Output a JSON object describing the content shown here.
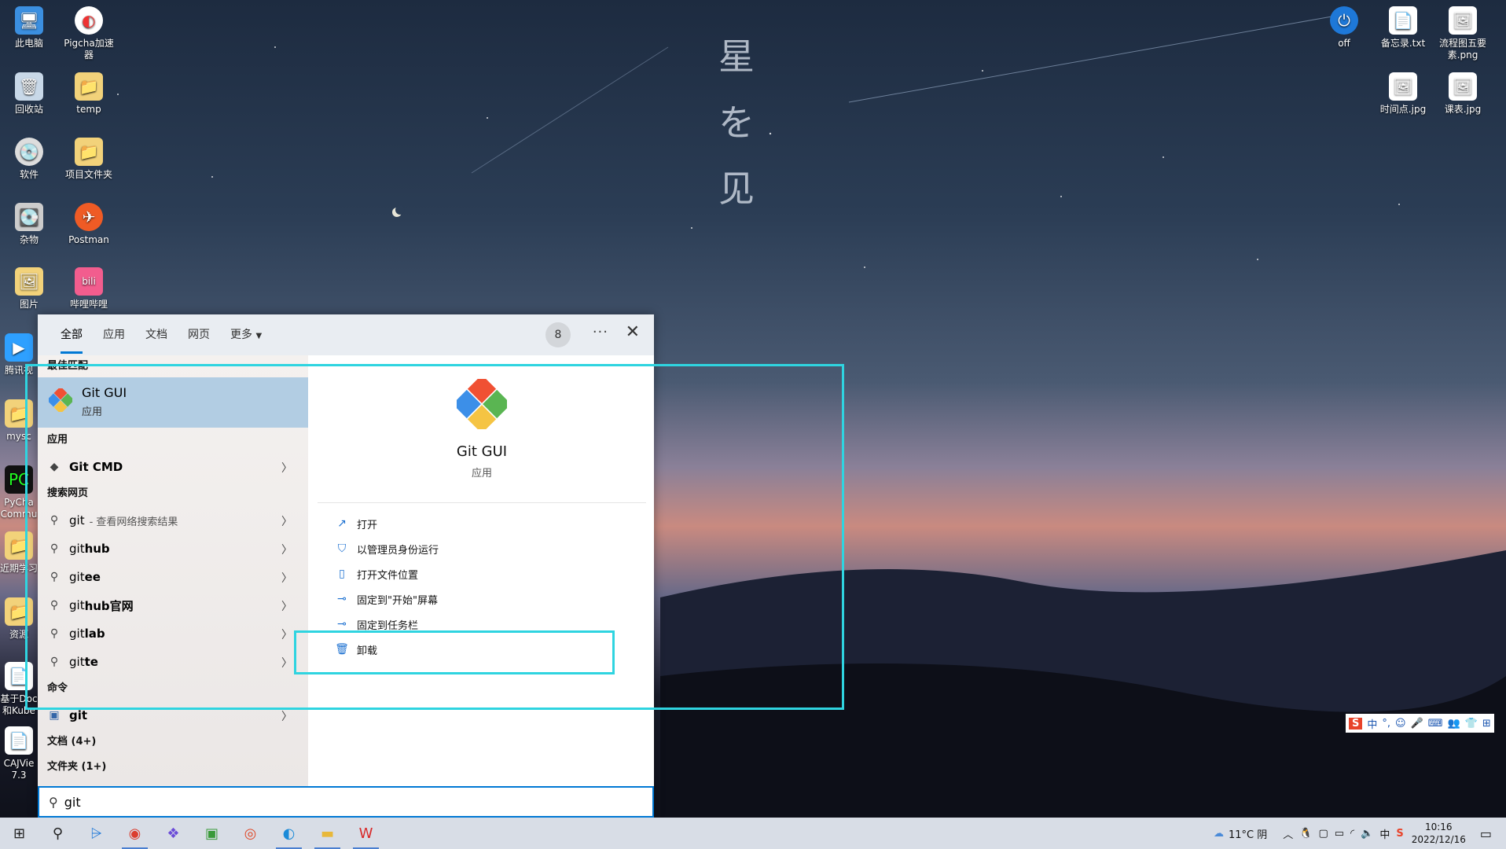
{
  "desktop": {
    "icons_left": [
      {
        "label": "此电脑",
        "icon": "computer-icon"
      },
      {
        "label": "Pigcha加速器",
        "icon": "pigcha-icon"
      },
      {
        "label": "回收站",
        "icon": "recycle-bin-icon"
      },
      {
        "label": "temp",
        "icon": "folder-icon"
      },
      {
        "label": "软件",
        "icon": "dvd-drive-icon"
      },
      {
        "label": "项目文件夹",
        "icon": "folder-icon"
      },
      {
        "label": "杂物",
        "icon": "drive-icon"
      },
      {
        "label": "Postman",
        "icon": "postman-icon"
      },
      {
        "label": "图片",
        "icon": "pictures-icon"
      },
      {
        "label": "哔哩哔哩",
        "icon": "bilibili-icon"
      }
    ],
    "icons_partial": [
      "腾讯视",
      "mysc",
      "PyCha Commu",
      "近期学习",
      "资源",
      "基于Doc和Kube",
      "CAJVie 7.3"
    ],
    "icons_right": [
      {
        "label": "off",
        "icon": "power-icon"
      },
      {
        "label": "备忘录.txt",
        "icon": "text-file-icon"
      },
      {
        "label": "流程图五要素.png",
        "icon": "image-file-icon"
      },
      {
        "label": "时间点.jpg",
        "icon": "image-file-icon"
      },
      {
        "label": "课表.jpg",
        "icon": "image-file-icon"
      }
    ],
    "poem": [
      "星",
      "を",
      "见"
    ]
  },
  "search": {
    "tabs": [
      "全部",
      "应用",
      "文档",
      "网页",
      "更多"
    ],
    "badge": "8",
    "best_match_header": "最佳匹配",
    "best_match": {
      "name": "Git GUI",
      "kind": "应用"
    },
    "apps_header": "应用",
    "apps": [
      {
        "name": "Git CMD"
      }
    ],
    "web_header": "搜索网页",
    "web": [
      {
        "prefix": "git",
        "bold": "",
        "sub": " - 查看网络搜索结果"
      },
      {
        "prefix": "git",
        "bold": "hub",
        "sub": ""
      },
      {
        "prefix": "git",
        "bold": "ee",
        "sub": ""
      },
      {
        "prefix": "git",
        "bold": "hub官网",
        "sub": ""
      },
      {
        "prefix": "git",
        "bold": "lab",
        "sub": ""
      },
      {
        "prefix": "git",
        "bold": "te",
        "sub": ""
      }
    ],
    "commands_header": "命令",
    "commands": [
      {
        "name": "git"
      }
    ],
    "docs_header": "文档 (4+)",
    "folders_header": "文件夹 (1+)",
    "query": "git",
    "detail": {
      "name": "Git GUI",
      "kind": "应用",
      "actions": [
        "打开",
        "以管理员身份运行",
        "打开文件位置",
        "固定到\"开始\"屏幕",
        "固定到任务栏",
        "卸载"
      ]
    }
  },
  "taskbar": {
    "weather": "11°C 阴",
    "time": "10:16",
    "date": "2022/12/16"
  },
  "ime": [
    "S",
    "中",
    "°,",
    "☺",
    "🎤",
    "⌨",
    "👥",
    "👕",
    "⊞"
  ]
}
